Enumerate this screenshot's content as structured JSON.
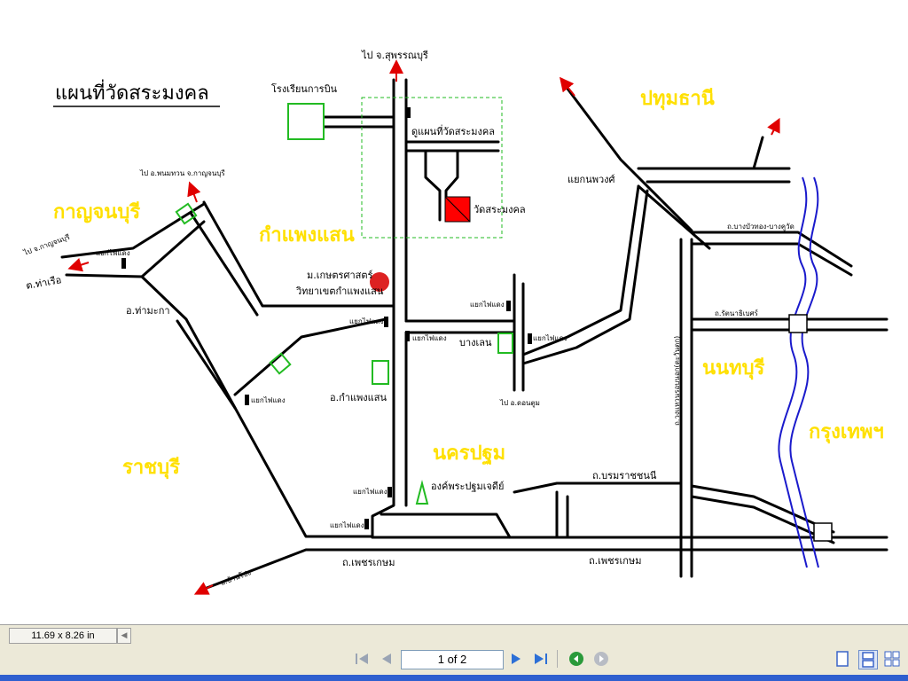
{
  "map": {
    "title": "แผนที่วัดสระมงคล",
    "provinces": {
      "pathum_thani": "ปทุมธานี",
      "kanchanaburi": "กาญจนบุรี",
      "kamphaeng_saen": "กำแพงแสน",
      "nonthaburi": "นนทบุรี",
      "bangkok": "กรุงเทพฯ",
      "ratchaburi": "ราชบุรี",
      "nakhon_pathom": "นครปฐม"
    },
    "places": {
      "to_suphanburi": "ไป จ.สุพรรณบุรี",
      "flight_school": "โรงเรียนการบิน",
      "temple_detail": "ดูแผนที่วัดสระมงคล",
      "temple": "วัดสระมงคล",
      "to_phanom_thuan": "ไป อ.พนมทวน จ.กาญจนบุรี",
      "to_kanchanaburi": "ไป จ.กาญจนบุรี",
      "tha_ruea": "ต.ท่าเรือ",
      "tha_maka": "อ.ท่ามะกา",
      "kasetsart_1": "ม.เกษตรศาสตร์",
      "kasetsart_2": "วิทยาเขตกำแพงแสน",
      "bang_len": "บางเลน",
      "amphoe_kamphaeng_saen": "อ.กำแพงแสน",
      "to_don_tum": "ไป อ.ดอนตูม",
      "phra_pathom_chedi": "องค์พระปฐมเจดีย์",
      "borommaratchachonnani": "ถ.บรมราชชนนี",
      "phetkasem_1": "ถ.เพชรเกษม",
      "phetkasem_2": "ถ.เพชรเกษม",
      "ban_pong": "อ.บ้านโป่ง",
      "kanmphong_junction": "แยกนพวงศ์",
      "ratchaphruek": "ถ.วงแหวนรอบนอก(ตะวันตก)",
      "rattanathibet": "ถ.รัตนาธิเบศร์",
      "bang_bua_thong": "ถ.บางบัวทอง-บางคูวัด"
    },
    "traffic_light": "แยกไฟแดง"
  },
  "viewer": {
    "page_size": "11.69 x 8.26 in",
    "page_indicator": "1 of 2"
  },
  "colors": {
    "province_label": "#ffe000",
    "route_arrow": "#e00000",
    "landmark_box": "#22bb22",
    "temple_fill": "#ff0000",
    "river": "#1a1acc"
  }
}
